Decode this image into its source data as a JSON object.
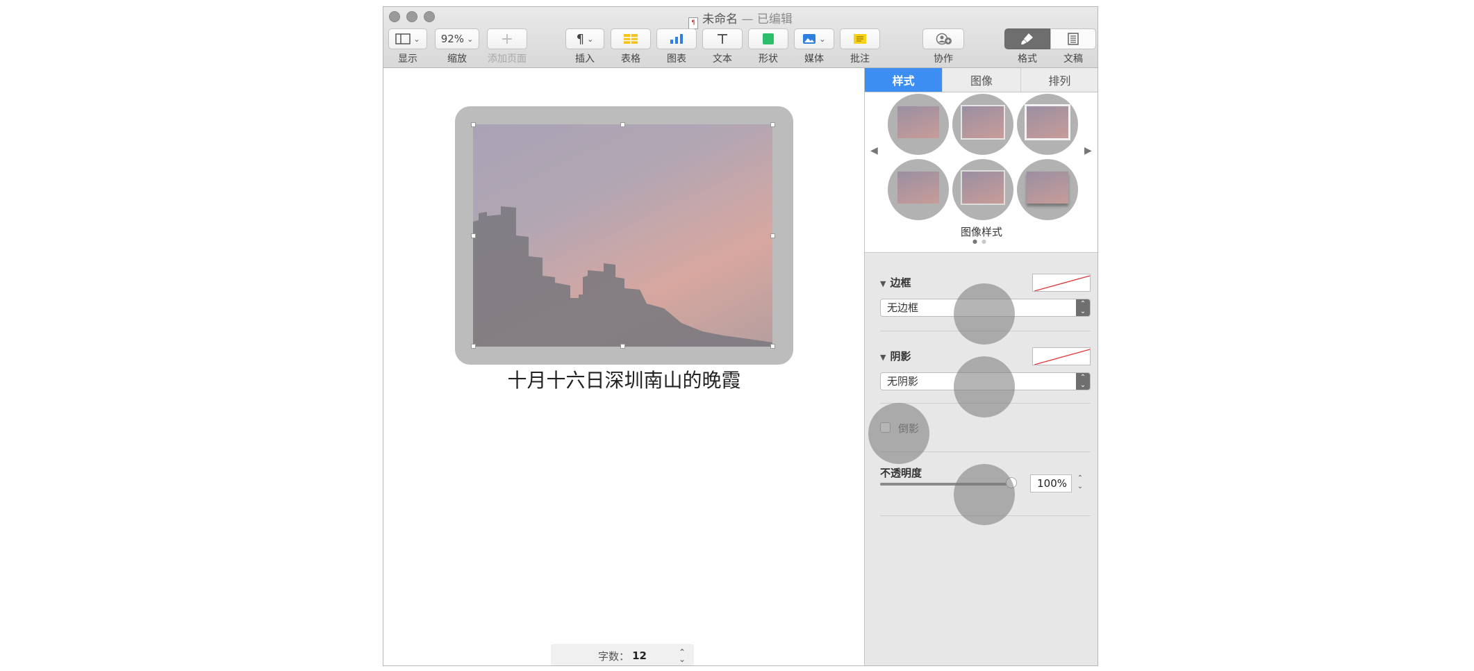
{
  "window": {
    "title": "未命名",
    "status": "— 已编辑"
  },
  "toolbar": {
    "view_label": "显示",
    "zoom_value": "92%",
    "zoom_label": "缩放",
    "add_page_label": "添加页面",
    "insert_label": "插入",
    "table_label": "表格",
    "chart_label": "图表",
    "text_label": "文本",
    "shape_label": "形状",
    "media_label": "媒体",
    "comment_label": "批注",
    "collaborate_label": "协作",
    "format_label": "格式",
    "document_label": "文稿"
  },
  "document": {
    "caption": "十月十六日深圳南山的晚霞",
    "word_count_label": "字数：",
    "word_count_value": "12"
  },
  "inspector": {
    "tabs": [
      "样式",
      "图像",
      "排列"
    ],
    "active_tab": "样式",
    "image_styles_label": "图像样式",
    "border_title": "边框",
    "border_value": "无边框",
    "shadow_title": "阴影",
    "shadow_value": "无阴影",
    "reflection_label": "倒影",
    "opacity_title": "不透明度",
    "opacity_value": "100%",
    "opacity_fraction": 1.0
  },
  "colors": {
    "accent": "#3d8ef3",
    "comment_yellow": "#f7d117",
    "shape_green": "#2bbf6a",
    "chart_blue": "#2f7fe0"
  }
}
